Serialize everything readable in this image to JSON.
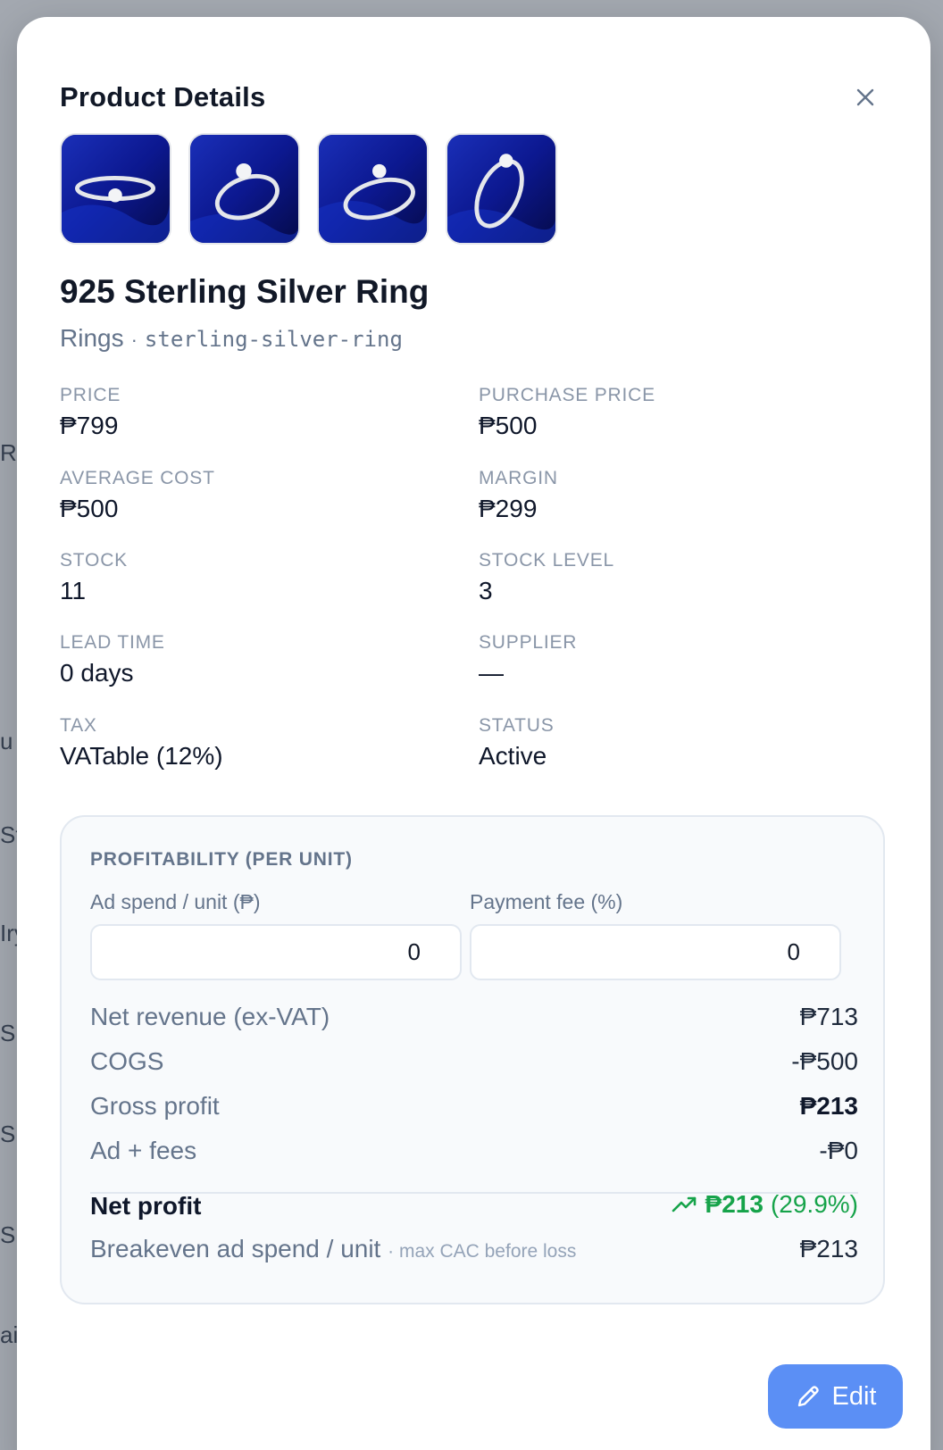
{
  "dialog": {
    "title": "Product Details"
  },
  "product": {
    "name": "925 Sterling Silver Ring",
    "category": "Rings",
    "separator": "·",
    "slug": "sterling-silver-ring"
  },
  "fields": {
    "price": {
      "label": "PRICE",
      "value": "₱799"
    },
    "purchase_price": {
      "label": "PURCHASE PRICE",
      "value": "₱500"
    },
    "average_cost": {
      "label": "AVERAGE COST",
      "value": "₱500"
    },
    "margin": {
      "label": "MARGIN",
      "value": "₱299"
    },
    "stock": {
      "label": "STOCK",
      "value": "11"
    },
    "stock_level": {
      "label": "STOCK LEVEL",
      "value": "3"
    },
    "lead_time": {
      "label": "LEAD TIME",
      "value": "0 days"
    },
    "supplier": {
      "label": "SUPPLIER",
      "value": "—"
    },
    "tax": {
      "label": "TAX",
      "value": "VATable (12%)"
    },
    "status": {
      "label": "STATUS",
      "value": "Active"
    }
  },
  "profitability": {
    "title": "PROFITABILITY (PER UNIT)",
    "ad_spend_label": "Ad spend / unit (₱)",
    "ad_spend_value": "0",
    "payment_fee_label": "Payment fee (%)",
    "payment_fee_value": "0",
    "net_revenue_label": "Net revenue (ex-VAT)",
    "net_revenue_value": "₱713",
    "cogs_label": "COGS",
    "cogs_value": "-₱500",
    "gross_profit_label": "Gross profit",
    "gross_profit_value": "₱213",
    "ad_fees_label": "Ad + fees",
    "ad_fees_value": "-₱0",
    "net_profit_label": "Net profit",
    "net_profit_value": "₱213",
    "net_profit_pct": "(29.9%)",
    "breakeven_label": "Breakeven ad spend / unit",
    "breakeven_hint": "· max CAC before loss",
    "breakeven_value": "₱213"
  },
  "actions": {
    "edit_label": "Edit"
  },
  "colors": {
    "accent": "#5b8ff5",
    "positive": "#16a34a",
    "thumb_bg": "#0f1a7a"
  },
  "icons": {
    "close": "close-icon",
    "edit": "pencil-icon",
    "trend": "trending-up-icon"
  }
}
